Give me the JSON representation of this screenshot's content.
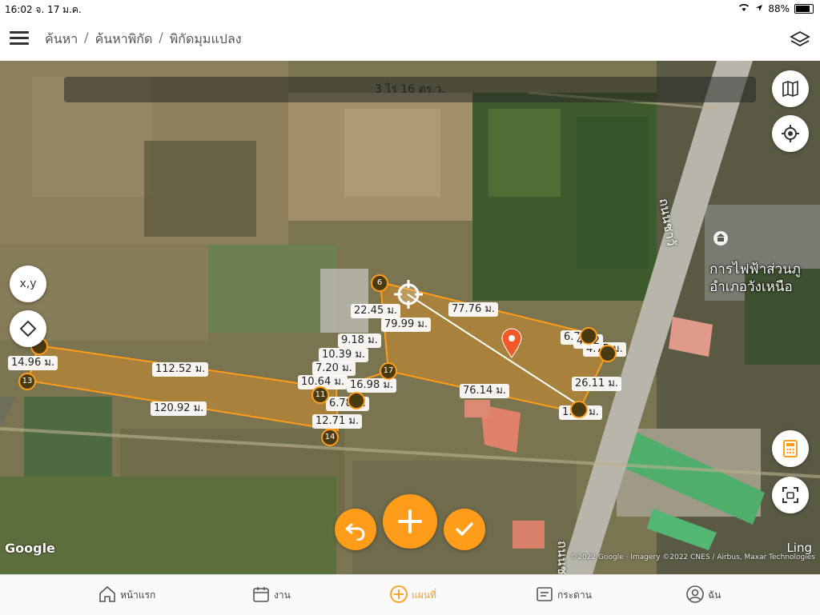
{
  "status": {
    "time": "16:02",
    "date": "จ. 17 ม.ค.",
    "battery": "88%",
    "icons": [
      "wifi-icon",
      "location-arrow-icon",
      "battery-icon"
    ]
  },
  "header": {
    "breadcrumb": [
      "ค้นหา",
      "ค้นหาพิกัด",
      "พิกัดมุมแปลง"
    ],
    "menu_icon": "hamburger-icon",
    "layers_icon": "layers-icon"
  },
  "map": {
    "area_text": "3 ไร่ 16 ตร.ว.",
    "road_name": "ถนนชาวั",
    "road_name_bottom": "ถนนชา",
    "poi_line1": "การไฟฟ้าส่วนภู",
    "poi_line2": "อำเภอวังเหนือ",
    "google": "Google",
    "ling": "Ling",
    "attribution": "©2022 Google · Imagery ©2022 CNES / Airbus, Maxar Technologies",
    "measurements": [
      "22.45 ม.",
      "77.76 ม.",
      "79.99 ม.",
      "9.18 ม.",
      "10.39 ม.",
      "7.20 ม.",
      "16.98 ม.",
      "10.64 ม.",
      "6.78 ม.",
      "12.71 ม.",
      "112.52 ม.",
      "120.92 ม.",
      "14.96 ม.",
      "76.14 ม.",
      "26.11 ม.",
      "1.64 ม.",
      "4.75 ม.",
      "6.79",
      "4.92"
    ],
    "vertices": [
      "6",
      "17",
      "11",
      "13",
      "14"
    ],
    "buttons": {
      "xy": "x,y",
      "map_icon": "map-icon",
      "locate_icon": "crosshair-icon",
      "diamond_icon": "diamond-icon",
      "calc_icon": "calculator-icon",
      "scan_icon": "scan-icon",
      "undo_icon": "undo-icon",
      "add_icon": "plus-icon",
      "confirm_icon": "check-icon"
    },
    "accent": "#ff9c1a"
  },
  "tabs": [
    {
      "label": "หน้าแรก",
      "icon": "home-icon"
    },
    {
      "label": "งาน",
      "icon": "calendar-icon"
    },
    {
      "label": "แผนที่",
      "icon": "map-plus-icon"
    },
    {
      "label": "กระดาน",
      "icon": "board-icon"
    },
    {
      "label": "ฉัน",
      "icon": "user-icon"
    }
  ]
}
